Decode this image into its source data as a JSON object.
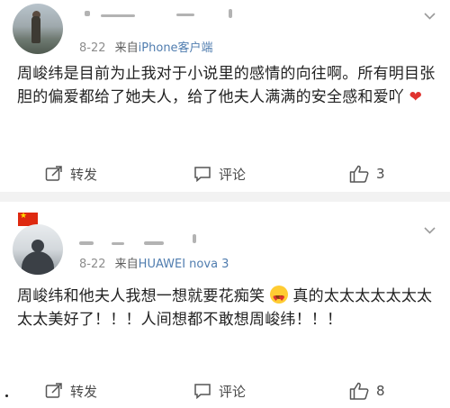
{
  "posts": [
    {
      "meta": {
        "date": "8-22",
        "source_prefix": "来自",
        "source": "iPhone客户端"
      },
      "content": "周峻纬是目前为止我对于小说里的感情的向往啊。所有明目张胆的偏爱都给了她夫人，给了他夫人满满的安全感和爱吖",
      "actions": {
        "repost": "转发",
        "comment": "评论",
        "like_count": "3"
      }
    },
    {
      "meta": {
        "date": "8-22",
        "source_prefix": "来自",
        "source": "HUAWEI nova 3"
      },
      "content_before_emoji": "周峻纬和他夫人我想一想就要花痴笑",
      "content_after_emoji": "真的太太太太太太太太太美好了！！！人间想都不敢想周峻纬！！！",
      "actions": {
        "repost": "转发",
        "comment": "评论",
        "like_count": "8"
      }
    }
  ],
  "icons": {
    "heart_emoji": "red-heart",
    "heart_eyes_emoji": "smiling-face-with-heart-eyes",
    "flag": "china-flag"
  },
  "colors": {
    "link": "#507daf",
    "heart": "#e0332f",
    "text": "#222222",
    "meta": "#8d8d8d"
  }
}
